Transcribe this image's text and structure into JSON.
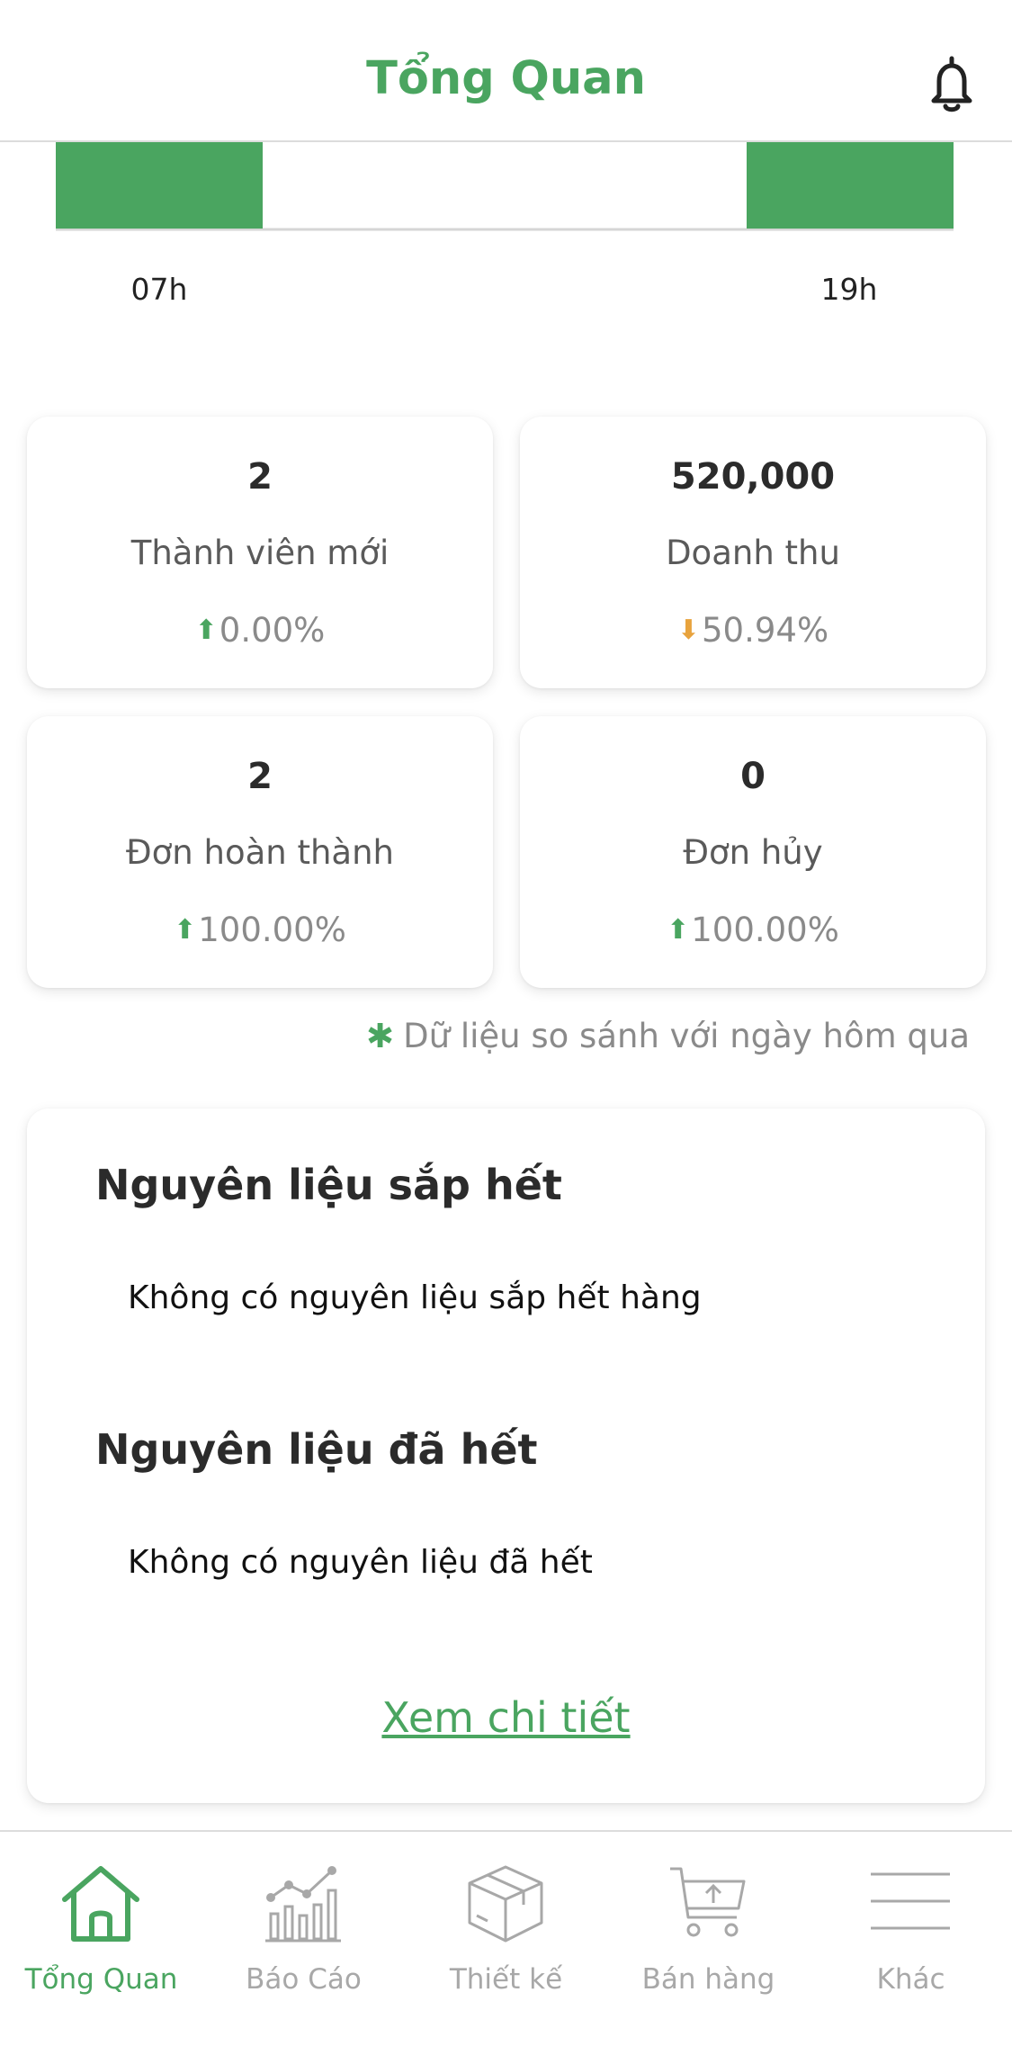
{
  "header": {
    "title": "Tổng Quan",
    "bell_icon": "bell-icon"
  },
  "chart_data": {
    "type": "bar",
    "categories": [
      "07h",
      "19h"
    ],
    "values": [
      1,
      1
    ],
    "title": "",
    "xlabel": "",
    "ylabel": "",
    "ylim": [
      0,
      1
    ],
    "color": "#4aa560"
  },
  "stats": [
    {
      "value": "2",
      "label": "Thành viên mới",
      "change": "0.00%",
      "trend": "up"
    },
    {
      "value": "520,000",
      "label": "Doanh thu",
      "change": "50.94%",
      "trend": "down"
    },
    {
      "value": "2",
      "label": "Đơn hoàn thành",
      "change": "100.00%",
      "trend": "up"
    },
    {
      "value": "0",
      "label": "Đơn hủy",
      "change": "100.00%",
      "trend": "up"
    }
  ],
  "comparison_note": "Dữ liệu so sánh với ngày hôm qua",
  "inventory": {
    "low_title": "Nguyên liệu sắp hết",
    "low_text": "Không có nguyên liệu sắp hết hàng",
    "out_title": "Nguyên liệu đã hết",
    "out_text": "Không có nguyên liệu đã hết",
    "detail_link": "Xem chi tiết"
  },
  "nav": {
    "items": [
      {
        "label": "Tổng Quan",
        "icon": "home-icon",
        "active": true
      },
      {
        "label": "Báo Cáo",
        "icon": "chart-icon",
        "active": false
      },
      {
        "label": "Thiết kế",
        "icon": "box-icon",
        "active": false
      },
      {
        "label": "Bán hàng",
        "icon": "cart-icon",
        "active": false
      },
      {
        "label": "Khác",
        "icon": "menu-icon",
        "active": false
      }
    ]
  },
  "colors": {
    "accent": "#4aa560",
    "up": "#4aa560",
    "down": "#e8a33d",
    "inactive": "#a8a8a8"
  }
}
